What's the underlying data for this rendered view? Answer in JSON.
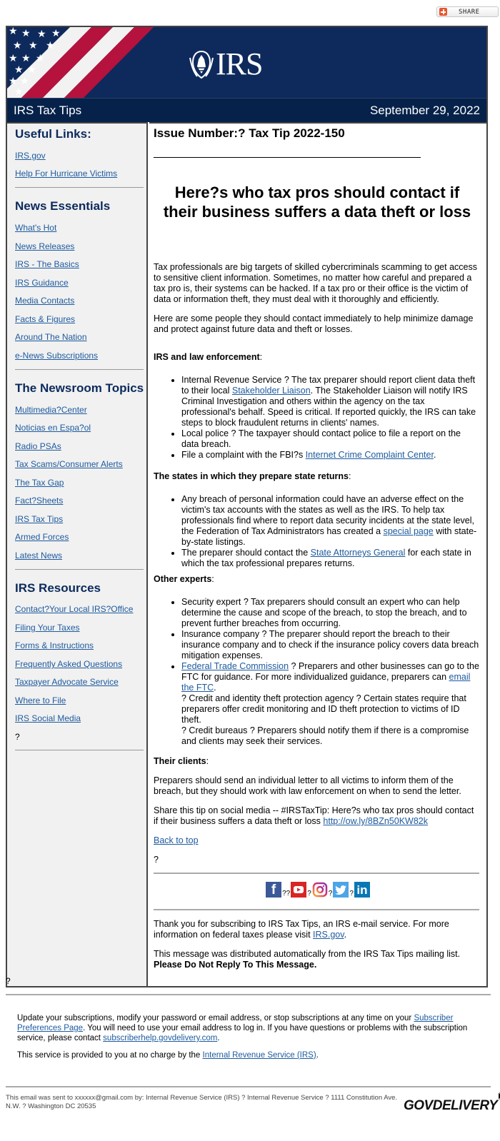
{
  "share": {
    "label": "SHARE",
    "icon": "plus-icon"
  },
  "header": {
    "logo_text": "IRS",
    "logo_icon": "irs-eagle-icon",
    "newsletter_title": "IRS Tax Tips",
    "date": "September 29, 2022",
    "colors": {
      "navy": "#0e2a5c",
      "dark_navy": "#06224a",
      "flag_red": "#b5123e"
    }
  },
  "sidebar": {
    "sections": [
      {
        "heading": "Useful Links:",
        "links": [
          "IRS.gov",
          "Help For Hurricane Victims"
        ]
      },
      {
        "heading": "News Essentials",
        "links": [
          "What's Hot",
          "News Releases",
          "IRS - The Basics",
          "IRS Guidance",
          "Media Contacts",
          "Facts & Figures",
          "Around The Nation",
          "e-News Subscriptions"
        ]
      },
      {
        "heading": "The Newsroom Topics",
        "links": [
          "Multimedia?Center",
          "Noticias en Espa?ol",
          "Radio PSAs",
          "Tax Scams/Consumer Alerts",
          "The Tax Gap",
          "Fact?Sheets",
          "IRS Tax Tips",
          "Armed Forces",
          "Latest News"
        ]
      },
      {
        "heading": "IRS Resources",
        "links": [
          "Contact?Your Local IRS?Office",
          "Filing Your Taxes",
          "Forms & Instructions",
          "Frequently Asked Questions",
          "Taxpayer Advocate Service",
          "Where to File",
          "IRS Social Media"
        ],
        "trailing": "?"
      }
    ]
  },
  "article": {
    "issue": "Issue Number:? Tax Tip 2022-150",
    "underline": "_______________________________________________",
    "headline": "Here?s who tax pros should contact if their business suffers a data theft or loss",
    "intro1": "Tax professionals are big targets of skilled cybercriminals scamming to get access to sensitive client information. Sometimes, no matter how careful and prepared a tax pro is, their systems can be hacked. If a tax pro or their office is the victim of data or information theft, they must deal with it thoroughly and efficiently.",
    "intro2": "Here are some people they should contact immediately to help minimize damage and protect against future data and theft or losses.",
    "sec1": {
      "heading": "IRS and law enforcement",
      "colon": ":",
      "li1_pre": "Internal Revenue Service ? The tax preparer should report client data theft to their local ",
      "li1_link": "Stakeholder Liaison",
      "li1_post": ". The Stakeholder Liaison will notify IRS Criminal Investigation and others within the agency on the tax professional's behalf. Speed is critical. If reported quickly, the IRS can take steps to block fraudulent returns in clients' names.",
      "li2": "Local police ? The taxpayer should contact police to file a report on the data breach.",
      "li3_pre": "File a complaint with the FBI?s ",
      "li3_link": "Internet Crime Complaint Center",
      "li3_post": "."
    },
    "sec2": {
      "heading": "The states in which they prepare state returns",
      "colon": ":",
      "li1_pre": "Any breach of personal information could have an adverse effect on the victim's tax accounts with the states as well as the IRS. To help tax professionals find where to report data security incidents at the state level, the Federation of Tax Administrators has created a ",
      "li1_link": "special page",
      "li1_post": " with state-by-state listings.",
      "li2_pre": "The preparer should contact the ",
      "li2_link": "State Attorneys General",
      "li2_post": " for each state in which the tax professional prepares returns."
    },
    "sec3": {
      "heading": "Other experts",
      "colon": ":",
      "li1": "Security expert ? Tax preparers should consult an expert who can help determine the cause and scope of the breach, to stop the breach, and to prevent further breaches from occurring.",
      "li2": "Insurance company ? The preparer should report the breach to their insurance company and to check if the insurance policy covers data breach mitigation expenses.",
      "li3_link": "Federal Trade Commission",
      "li3_mid": " ? Preparers and other businesses can go to the FTC for guidance. For more individualized guidance, preparers can ",
      "li3_link2": "email the FTC",
      "li3_post": ".",
      "li3_line2": "? Credit and identity theft protection agency ? Certain states require that preparers offer credit monitoring and ID theft protection to victims of ID theft.",
      "li3_line3": "? Credit bureaus ? Preparers should notify them if there is a compromise and clients may seek their services."
    },
    "sec4": {
      "heading": "Their clients",
      "colon": ":",
      "body": "Preparers should send an individual letter to all victims to inform them of the breach, but they should work with law enforcement on when to send the letter."
    },
    "share_text": "Share this tip on social media -- #IRSTaxTip: Here?s who tax pros should contact if their business suffers a data theft or loss ",
    "share_link": "http://ow.ly/8BZn50KW82k",
    "back_to_top": "Back to top",
    "spacer_q": "?",
    "social": {
      "icons": [
        "facebook-icon",
        "youtube-icon",
        "instagram-icon",
        "twitter-icon",
        "linkedin-icon"
      ],
      "separators": [
        "??",
        "?",
        "?",
        "?"
      ]
    },
    "thanks_pre": "Thank you for subscribing to IRS Tax Tips, an IRS e-mail service. For more information on federal taxes please visit ",
    "thanks_link": "IRS.gov",
    "thanks_post": ".",
    "distributed": "This message was distributed automatically from the IRS Tax Tips mailing list. ",
    "distributed_bold": "Please Do Not Reply To This Message."
  },
  "footer": {
    "spacer_q": "?",
    "update_pre": "Update your subscriptions, modify your password or email address, or stop subscriptions at any time on your ",
    "update_link": "Subscriber Preferences Page",
    "update_mid": ". You will need to use your email address to log in. If you have questions or problems with the subscription service, please contact ",
    "update_link2": "subscriberhelp.govdelivery.com",
    "update_post": ".",
    "service_pre": "This service is provided to you at no charge by the ",
    "service_link": "Internal Revenue Service (IRS)",
    "service_post": ".",
    "sent_to": "This email was sent to xxxxxx@gmail.com by: Internal Revenue Service (IRS) ? Internal Revenue Service ? 1111 Constitution Ave. N.W. ? Washington DC 20535",
    "brand": "GOVDELIVERY"
  }
}
